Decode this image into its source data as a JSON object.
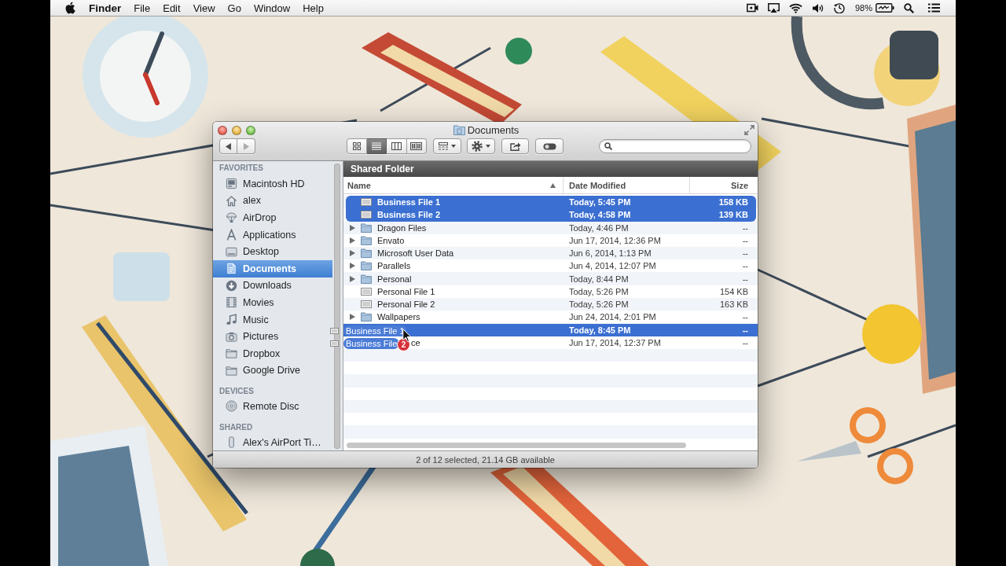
{
  "menu_bar": {
    "app_name": "Finder",
    "menus": [
      "File",
      "Edit",
      "View",
      "Go",
      "Window",
      "Help"
    ],
    "battery": "98%"
  },
  "window": {
    "title": "Documents",
    "nav": [
      {
        "kind": "back",
        "disabled": false
      },
      {
        "kind": "forward",
        "disabled": true
      }
    ],
    "views": [
      {
        "kind": "icons",
        "selected": false
      },
      {
        "kind": "list",
        "selected": true
      },
      {
        "kind": "columns",
        "selected": false
      },
      {
        "kind": "coverflow",
        "selected": false
      }
    ]
  },
  "sidebar": {
    "sections": [
      {
        "heading": "FAVORITES",
        "items": [
          {
            "label": "Macintosh HD",
            "kind": "drive",
            "selected": false
          },
          {
            "label": "alex",
            "kind": "home",
            "selected": false
          },
          {
            "label": "AirDrop",
            "kind": "airdrop",
            "selected": false
          },
          {
            "label": "Applications",
            "kind": "apps",
            "selected": false
          },
          {
            "label": "Desktop",
            "kind": "desktop",
            "selected": false
          },
          {
            "label": "Documents",
            "kind": "documents",
            "selected": true
          },
          {
            "label": "Downloads",
            "kind": "downloads",
            "selected": false
          },
          {
            "label": "Movies",
            "kind": "movies",
            "selected": false
          },
          {
            "label": "Music",
            "kind": "music",
            "selected": false
          },
          {
            "label": "Pictures",
            "kind": "pictures",
            "selected": false
          },
          {
            "label": "Dropbox",
            "kind": "folder",
            "selected": false
          },
          {
            "label": "Google Drive",
            "kind": "folder",
            "selected": false
          }
        ]
      },
      {
        "heading": "DEVICES",
        "items": [
          {
            "label": "Remote Disc",
            "kind": "disc",
            "selected": false
          }
        ]
      },
      {
        "heading": "SHARED",
        "items": [
          {
            "label": "Alex's AirPort Ti…",
            "kind": "device",
            "selected": false
          }
        ]
      }
    ]
  },
  "path_bar": {
    "label": "Shared Folder"
  },
  "table": {
    "columns": [
      {
        "label": "Name",
        "sorted": true
      },
      {
        "label": "Date Modified",
        "sorted": false
      },
      {
        "label": "Size",
        "sorted": false
      }
    ],
    "rows": [
      {
        "name": "Business File 1",
        "kind": "file",
        "date": "Today, 5:45 PM",
        "size": "158 KB",
        "selected": true,
        "drop_target": false
      },
      {
        "name": "Business File 2",
        "kind": "file",
        "date": "Today, 4:58 PM",
        "size": "139 KB",
        "selected": true,
        "drop_target": false
      },
      {
        "name": "Dragon Files",
        "kind": "folder",
        "date": "Today, 4:46 PM",
        "size": "--",
        "selected": false,
        "drop_target": false
      },
      {
        "name": "Envato",
        "kind": "folder",
        "date": "Jun 17, 2014, 12:36 PM",
        "size": "--",
        "selected": false,
        "drop_target": false
      },
      {
        "name": "Microsoft User Data",
        "kind": "folder",
        "date": "Jun 6, 2014, 1:13 PM",
        "size": "--",
        "selected": false,
        "drop_target": false
      },
      {
        "name": "Parallels",
        "kind": "folder",
        "date": "Jun 4, 2014, 12:07 PM",
        "size": "--",
        "selected": false,
        "drop_target": false
      },
      {
        "name": "Personal",
        "kind": "folder",
        "date": "Today, 8:44 PM",
        "size": "--",
        "selected": false,
        "drop_target": false
      },
      {
        "name": "Personal File 1",
        "kind": "file",
        "date": "Today, 5:26 PM",
        "size": "154 KB",
        "selected": false,
        "drop_target": false
      },
      {
        "name": "Personal File 2",
        "kind": "file",
        "date": "Today, 5:26 PM",
        "size": "163 KB",
        "selected": false,
        "drop_target": false
      },
      {
        "name": "Wallpapers",
        "kind": "folder",
        "date": "Jun 24, 2014, 2:01 PM",
        "size": "--",
        "selected": false,
        "drop_target": false
      },
      {
        "kind": "covered",
        "date": "Today, 8:45 PM",
        "size": "--",
        "selected": false,
        "drop_target": true
      },
      {
        "name": "ce",
        "kind": "covered",
        "date": "Jun 17, 2014, 12:37 PM",
        "size": "--",
        "selected": false,
        "drop_target": false
      }
    ]
  },
  "drag": {
    "labels": [
      "Business File 1",
      "Business File"
    ],
    "badge": "2"
  },
  "status_bar": "2 of 12 selected, 21.14 GB available"
}
